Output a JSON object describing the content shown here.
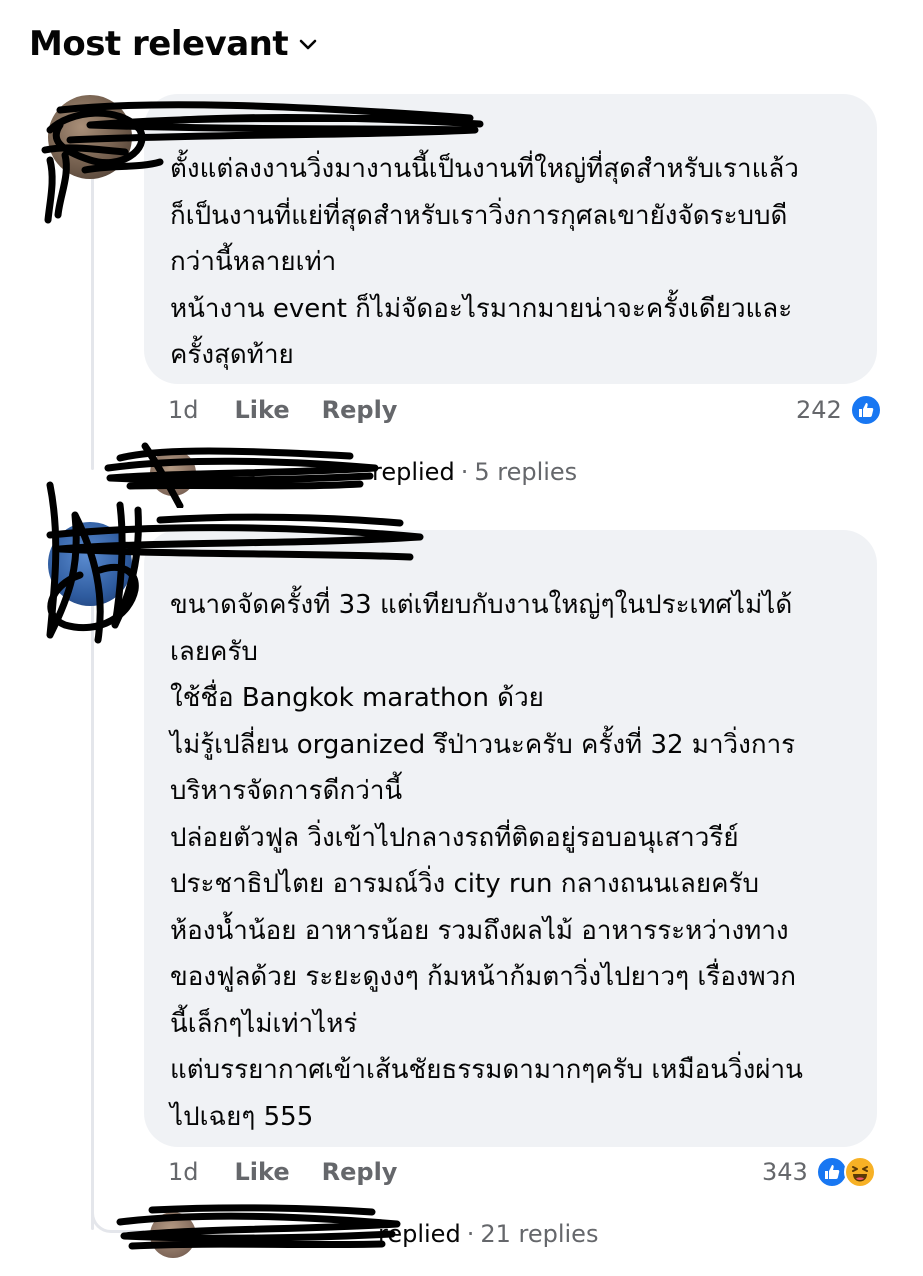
{
  "sort": {
    "label": "Most relevant",
    "icon": "chevron-down-icon"
  },
  "comments": [
    {
      "text": "ตั้งแต่ลงงานวิ่งมางานนี้เป็นงานที่ใหญ่ที่สุดสำหรับเราแล้ว\nก็เป็นงานที่แย่ที่สุดสำหรับเราวิ่งการกุศลเขายังจัดระบบดี\nกว่านี้หลายเท่า\nหน้างาน event ก็ไม่จัดอะไรมากมายน่าจะครั้งเดียวและ\nครั้งสุดท้าย",
      "age": "1d",
      "like_label": "Like",
      "reply_label": "Reply",
      "reaction_count": "242",
      "reactions": [
        "like"
      ],
      "replies": {
        "replied_label": "replied",
        "count_label": "5 replies"
      }
    },
    {
      "text": "ขนาดจัดครั้งที่ 33 แต่เทียบกับงานใหญ่ๆในประเทศไม่ได้\nเลยครับ\nใช้ชื่อ Bangkok marathon ด้วย\nไม่รู้เปลี่ยน organized รึป่าวนะครับ ครั้งที่ 32 มาวิ่งการ\nบริหารจัดการดีกว่านี้\nปล่อยตัวฟูล วิ่งเข้าไปกลางรถที่ติดอยู่รอบอนุเสาวรีย์\nประชาธิปไตย อารมณ์วิ่ง city run กลางถนนเลยครับ\nห้องน้ำน้อย อาหารน้อย รวมถึงผลไม้ อาหารระหว่างทาง\nของฟูลด้วย ระยะดูงงๆ ก้มหน้าก้มตาวิ่งไปยาวๆ เรื่องพวก\nนี้เล็กๆไม่เท่าไหร่\nแต่บรรยากาศเข้าเส้นชัยธรรมดามากๆครับ เหมือนวิ่งผ่าน\nไปเฉยๆ 555",
      "age": "1d",
      "like_label": "Like",
      "reply_label": "Reply",
      "reaction_count": "343",
      "reactions": [
        "like",
        "haha"
      ],
      "replies": {
        "replied_label": "replied",
        "count_label": "21 replies"
      }
    }
  ],
  "colors": {
    "like_blue": "#1877f2",
    "haha_yellow": "#f7b125",
    "bubble": "#f0f2f5",
    "meta": "#65676b"
  }
}
